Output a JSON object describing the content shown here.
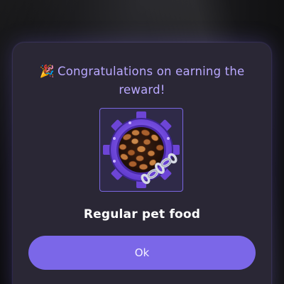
{
  "dialog": {
    "title_emoji": "🎉",
    "title": "Congratulations on earning the reward!",
    "reward": {
      "icon": "pet-food-bowl-icon",
      "name": "Regular pet food"
    },
    "ok_label": "Ok"
  },
  "colors": {
    "accent": "#7b67e8",
    "title_text": "#b9a8ff",
    "panel_bg": "#2a2735"
  }
}
